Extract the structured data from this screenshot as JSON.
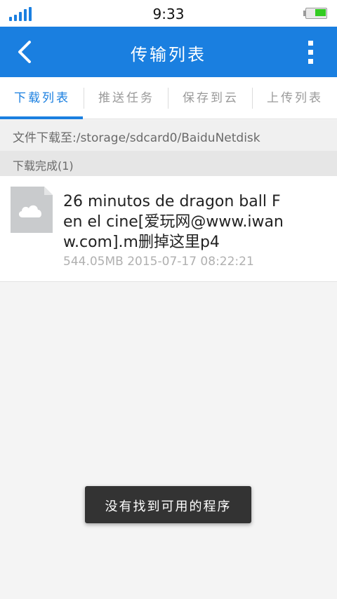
{
  "status_bar": {
    "time": "9:33",
    "signal_icon": "signal-strength-icon",
    "battery_icon": "battery-icon",
    "battery_level": 0.55,
    "battery_color": "#33cc22"
  },
  "app_bar": {
    "title": "传输列表",
    "back_icon": "chevron-left-icon",
    "more_icon": "more-vertical-icon",
    "color": "#1a7fe0"
  },
  "tabs": [
    {
      "label": "下载列表",
      "active": true
    },
    {
      "label": "推送任务",
      "active": false
    },
    {
      "label": "保存到云",
      "active": false
    },
    {
      "label": "上传列表",
      "active": false
    }
  ],
  "download_path": "文件下载至:/storage/sdcard0/BaiduNetdisk",
  "section": {
    "label": "下载完成(1)"
  },
  "files": [
    {
      "name": "26 minutos de dragon ball F  en el cine[爱玩网@www.iwanw.com].m删掉这里p4",
      "size": "544.05MB",
      "date": "2015-07-17 08:22:21",
      "icon": "cloud-file-icon"
    }
  ],
  "toast": {
    "message": "没有找到可用的程序"
  }
}
